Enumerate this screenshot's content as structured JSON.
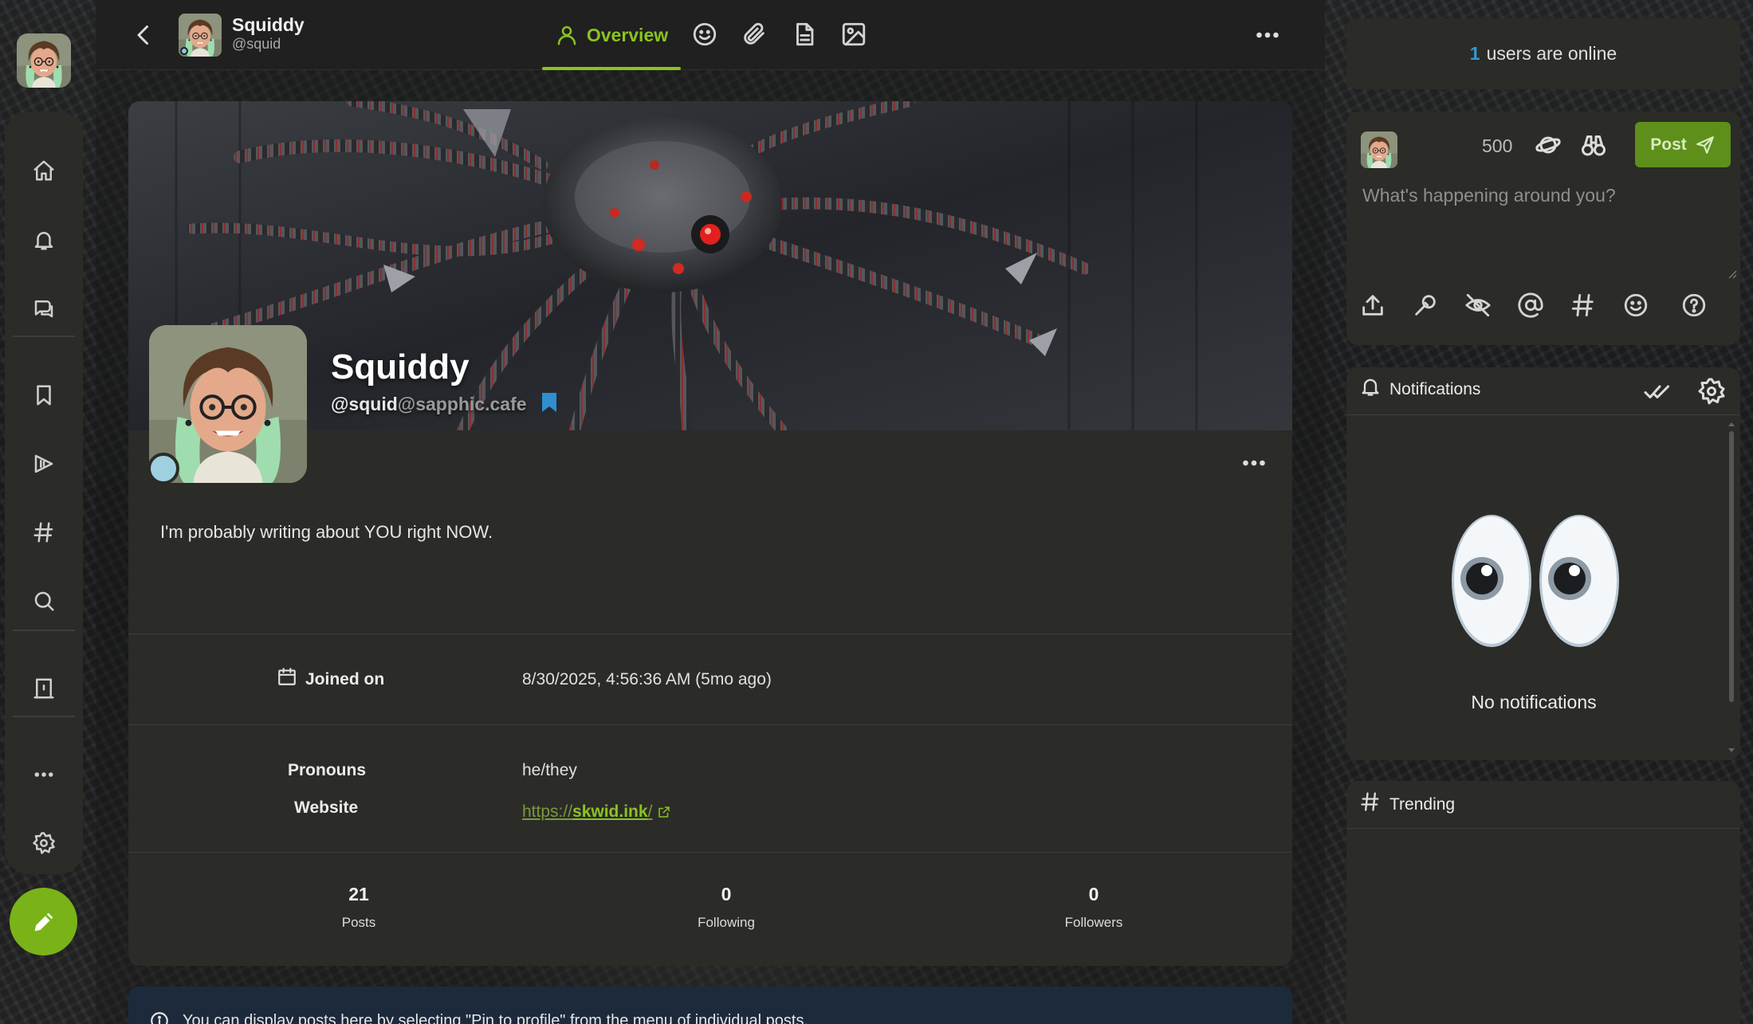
{
  "user": {
    "display_name": "Squiddy",
    "handle_short": "@squid",
    "handle_user": "@squid",
    "handle_domain": "@sapphic.cafe"
  },
  "tabs": {
    "overview_label": "Overview"
  },
  "profile": {
    "bio": "I'm probably writing about YOU right NOW.",
    "joined_label": "Joined on",
    "joined_value": "8/30/2025, 4:56:36 AM (5mo ago)",
    "pronouns_label": "Pronouns",
    "pronouns_value": "he/they",
    "website_label": "Website",
    "website_proto": "https://",
    "website_host": "skwid.ink",
    "website_slash": "/",
    "stats": [
      {
        "value": "21",
        "label": "Posts"
      },
      {
        "value": "0",
        "label": "Following"
      },
      {
        "value": "0",
        "label": "Followers"
      }
    ],
    "pin_note": "You can display posts here by selecting \"Pin to profile\" from the menu of individual posts."
  },
  "sidebar": {
    "online_count": "1",
    "online_text": "users are online",
    "compose": {
      "char_count": "500",
      "post_label": "Post",
      "placeholder": "What's happening around you?"
    },
    "notifications": {
      "title": "Notifications",
      "empty_text": "No notifications"
    },
    "trending": {
      "title": "Trending"
    }
  },
  "colors": {
    "accent": "#8bc320",
    "online_blue": "#2f9bd6",
    "panel": "#2b2b28"
  },
  "icons": {
    "rail": [
      "home-icon",
      "bell-icon",
      "chat-icon",
      "bookmark-icon",
      "hashtag-follow-icon",
      "hashtag-icon",
      "search-icon",
      "building-icon",
      "more-icon",
      "gear-icon"
    ],
    "tabs": [
      "user-icon",
      "emoji-icon",
      "paperclip-icon",
      "document-icon",
      "image-icon"
    ],
    "compose_tools": [
      "upload-icon",
      "microphone-icon",
      "eye-off-icon",
      "mention-icon",
      "hashtag-icon",
      "emoji-icon",
      "help-icon"
    ]
  }
}
